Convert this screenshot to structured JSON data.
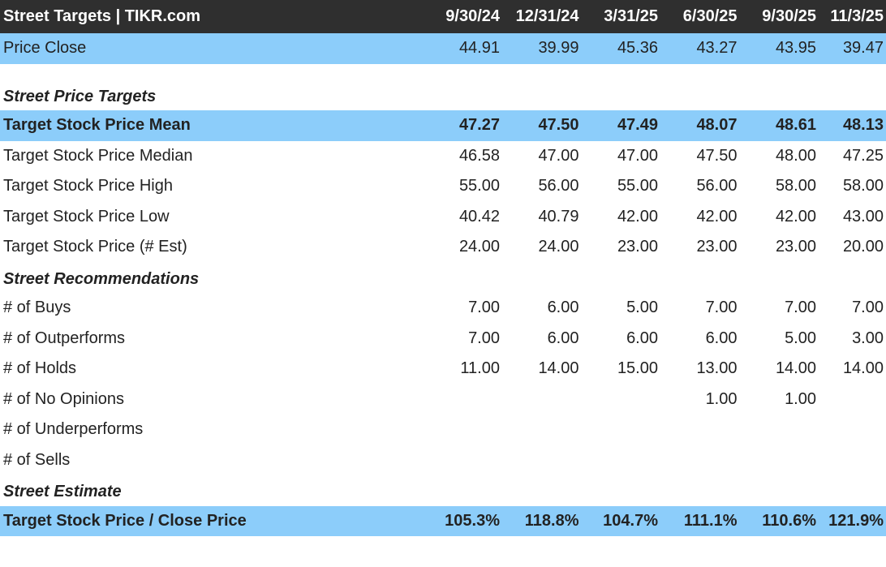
{
  "header": {
    "title": "Street Targets | TIKR.com",
    "dates": [
      "9/30/24",
      "12/31/24",
      "3/31/25",
      "6/30/25",
      "9/30/25",
      "11/3/25"
    ]
  },
  "price_close": {
    "label": "Price Close",
    "values": [
      "44.91",
      "39.99",
      "45.36",
      "43.27",
      "43.95",
      "39.47"
    ]
  },
  "sections": {
    "price_targets": "Street Price Targets",
    "recommendations": "Street Recommendations",
    "estimate": "Street Estimate"
  },
  "target_mean": {
    "label": "Target Stock Price Mean",
    "values": [
      "47.27",
      "47.50",
      "47.49",
      "48.07",
      "48.61",
      "48.13"
    ]
  },
  "target_median": {
    "label": "Target Stock Price Median",
    "values": [
      "46.58",
      "47.00",
      "47.00",
      "47.50",
      "48.00",
      "47.25"
    ]
  },
  "target_high": {
    "label": "Target Stock Price High",
    "values": [
      "55.00",
      "56.00",
      "55.00",
      "56.00",
      "58.00",
      "58.00"
    ]
  },
  "target_low": {
    "label": "Target Stock Price Low",
    "values": [
      "40.42",
      "40.79",
      "42.00",
      "42.00",
      "42.00",
      "43.00"
    ]
  },
  "target_est": {
    "label": "Target Stock Price (# Est)",
    "values": [
      "24.00",
      "24.00",
      "23.00",
      "23.00",
      "23.00",
      "20.00"
    ]
  },
  "buys": {
    "label": "# of Buys",
    "values": [
      "7.00",
      "6.00",
      "5.00",
      "7.00",
      "7.00",
      "7.00"
    ]
  },
  "outperforms": {
    "label": "# of Outperforms",
    "values": [
      "7.00",
      "6.00",
      "6.00",
      "6.00",
      "5.00",
      "3.00"
    ]
  },
  "holds": {
    "label": "# of Holds",
    "values": [
      "11.00",
      "14.00",
      "15.00",
      "13.00",
      "14.00",
      "14.00"
    ]
  },
  "no_opinions": {
    "label": "# of No Opinions",
    "values": [
      "",
      "",
      "",
      "1.00",
      "1.00",
      ""
    ]
  },
  "underperforms": {
    "label": "# of Underperforms",
    "values": [
      "",
      "",
      "",
      "",
      "",
      ""
    ]
  },
  "sells": {
    "label": "# of Sells",
    "values": [
      "",
      "",
      "",
      "",
      "",
      ""
    ]
  },
  "target_close": {
    "label": "Target Stock Price / Close Price",
    "values": [
      "105.3%",
      "118.8%",
      "104.7%",
      "111.1%",
      "110.6%",
      "121.9%"
    ]
  },
  "colors": {
    "header_bg": "#2f2f2f",
    "highlight_bg": "#8ccdfa"
  }
}
